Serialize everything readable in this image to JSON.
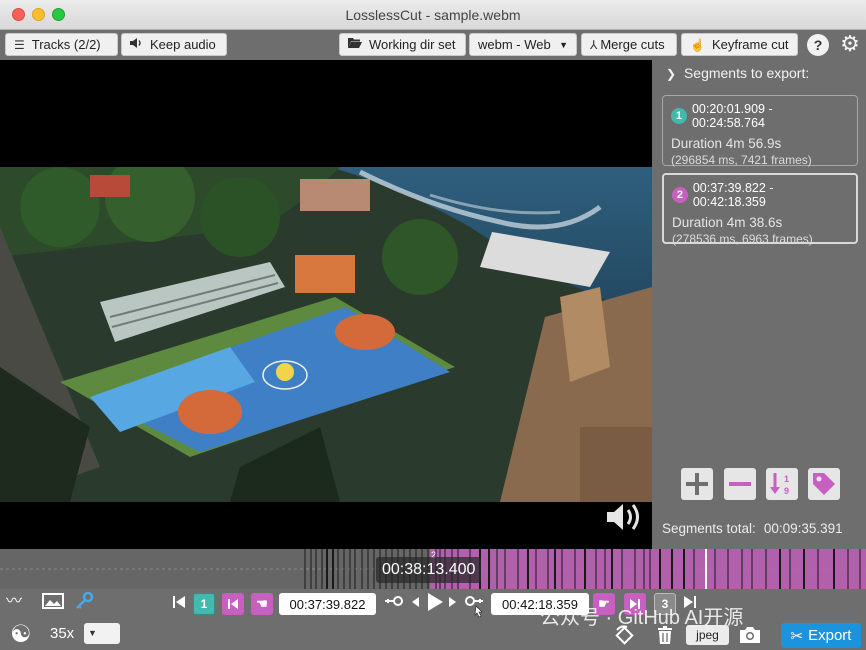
{
  "window": {
    "title": "LosslessCut - sample.webm"
  },
  "toolbar": {
    "tracks_label": "Tracks (2/2)",
    "keep_audio_label": "Keep audio",
    "working_dir_label": "Working dir set",
    "format_selected": "webm - Web",
    "merge_cuts_label": "Merge cuts",
    "keyframe_cut_label": "Keyframe cut",
    "help_label": "?"
  },
  "side_panel": {
    "header": "Segments to export:",
    "segments": [
      {
        "number": "1",
        "range": "00:20:01.909 - 00:24:58.764",
        "duration": "Duration 4m 56.9s",
        "detail": "(296854 ms, 7421 frames)",
        "color": "#43b9ad"
      },
      {
        "number": "2",
        "range": "00:37:39.822 - 00:42:18.359",
        "duration": "Duration 4m 38.6s",
        "detail": "(278536 ms, 6963 frames)",
        "color": "#c760c0"
      }
    ],
    "segments_total_label": "Segments total:",
    "segments_total_value": "00:09:35.391"
  },
  "timeline": {
    "current_time": "00:38:13.400",
    "segment_marker": "2"
  },
  "bottom": {
    "prev_segment_number": "1",
    "next_segment_number": "3",
    "cut_start_time": "00:37:39.822",
    "cut_end_time": "00:42:18.359",
    "zoom_level": "35x",
    "capture_format": "jpeg",
    "export_label": "Export",
    "watermark": "公众号 · GitHub AI开源"
  },
  "colors": {
    "segment_1": "#43b9ad",
    "segment_2": "#c760c0",
    "export": "#1b94dd"
  }
}
